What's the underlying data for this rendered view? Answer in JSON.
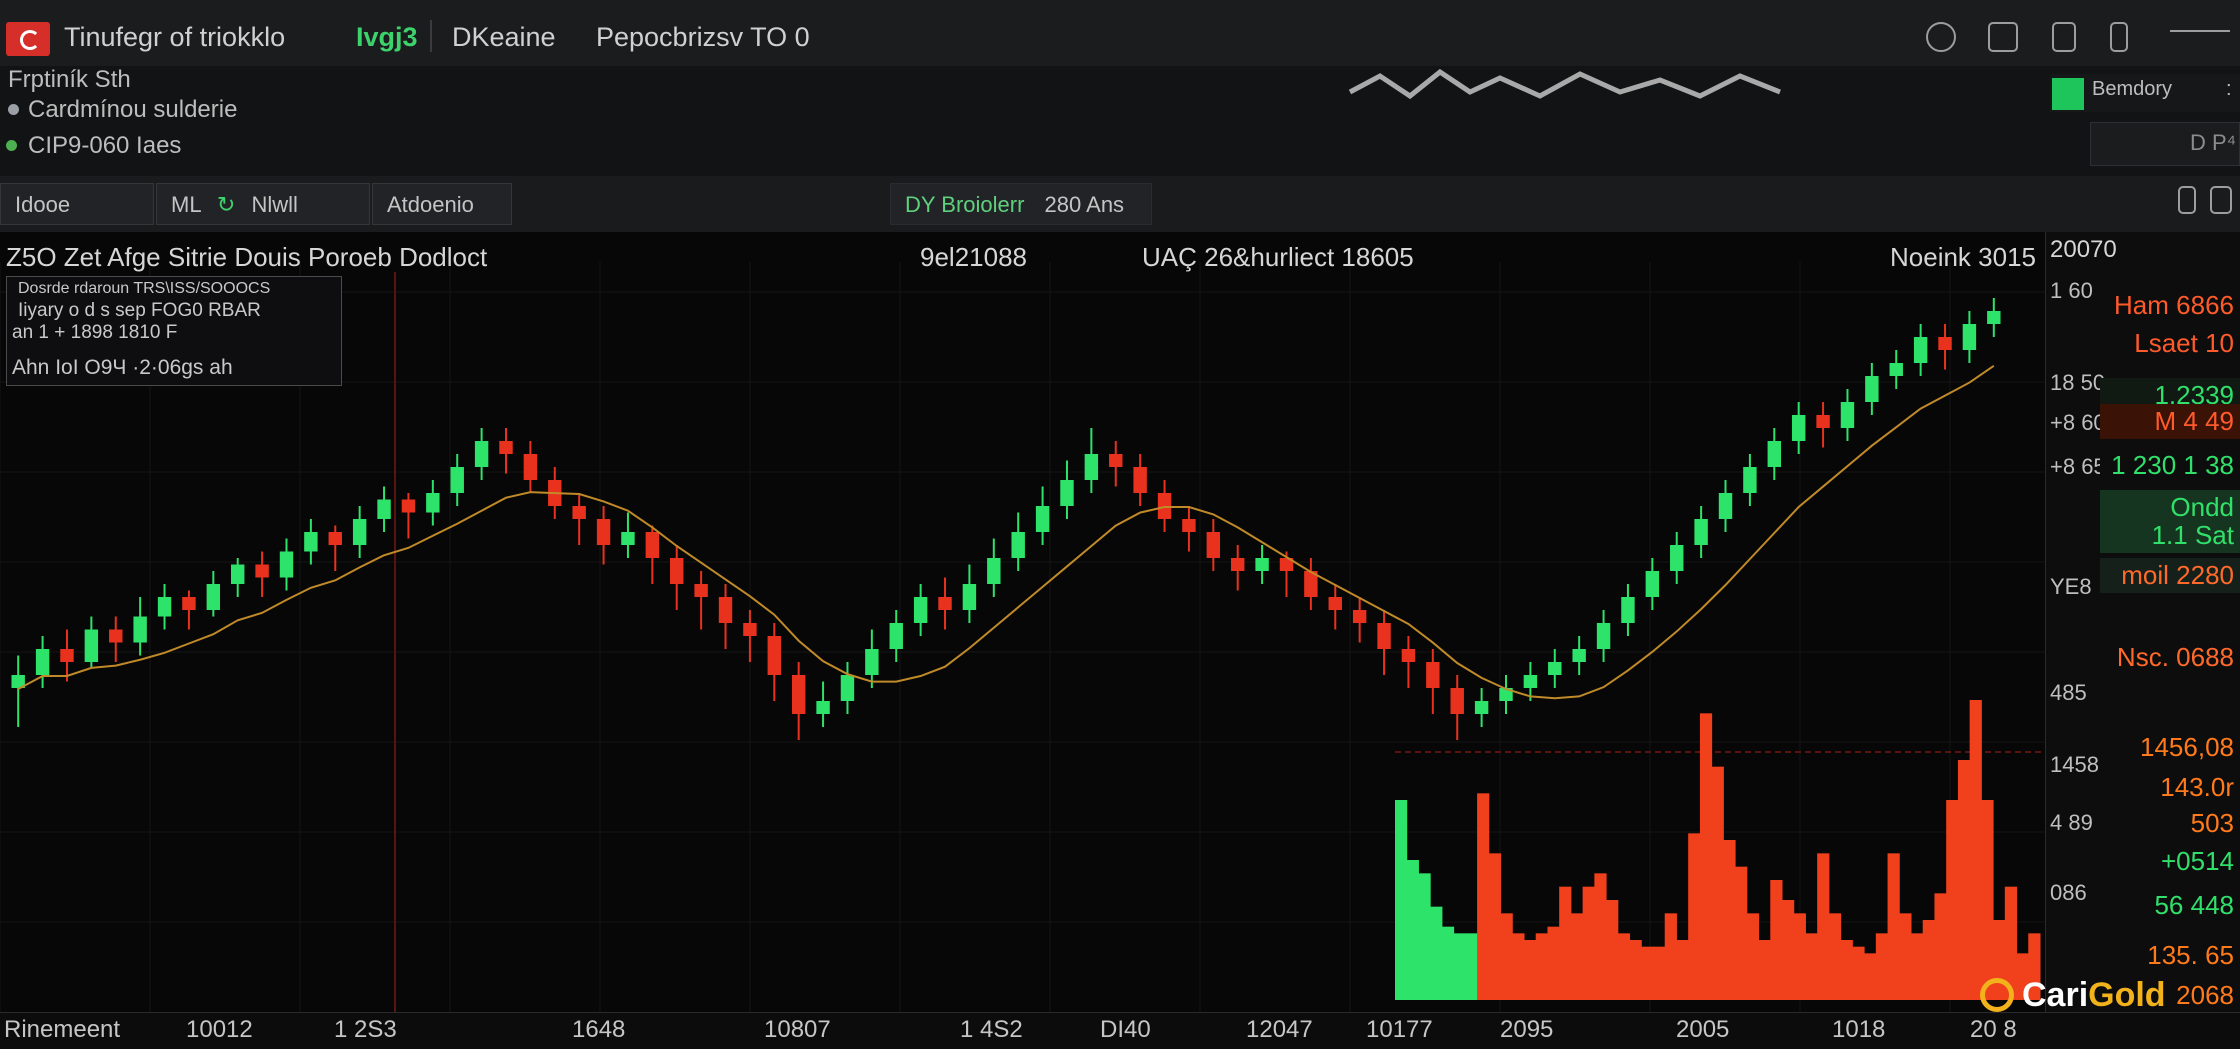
{
  "window": {
    "title": "Tinufegr of triokklo",
    "badge": "Ivgj3",
    "tab1": "DKeaine",
    "tab2": "Pepocbrizsv TO 0"
  },
  "info": {
    "line1": "Frptiník Sth",
    "line2": "Cardmínou sulderie",
    "line3": "CIP9-060 Iaes",
    "dot2_color": "#9aa0a6",
    "dot3_color": "#4caf50",
    "brand_button": "Bemdory",
    "brand_button_suffix": ":",
    "dp_box": "D P⁴"
  },
  "toolbar": {
    "btn1": "Idooe",
    "btn2": "ML",
    "btn2b": "Nlwll",
    "btn3": "Atdoenio",
    "indicator": "DY Broiolerr",
    "indicator_value": "280 Ans"
  },
  "chart_header": {
    "left": "Z5O Zet Afge Sitrie Douis Poroeb Dodloct",
    "center1": "9el21088",
    "center2": "UAÇ 26&hurliect 18605",
    "right": "Noeink 3015",
    "axis_top": "20070"
  },
  "legend": {
    "line1": "Dosrde rdaroun TRS\\ISS/SOOOCS",
    "line2": "Iiyary o d s sep  FOG0 RBAR",
    "line3": "an 1 + 1898  1810 F",
    "line4": "Ahn IoI O9Ч ·2·06gs ah"
  },
  "y_axis": {
    "labels": [
      "1 60",
      "18 50",
      "+8 60",
      "+8 65",
      "YE8",
      "485",
      "1458",
      "4 89",
      "086"
    ]
  },
  "price_tags": [
    {
      "text": "Ham 6866",
      "color": "#ff5a2a",
      "bg": "#0d0d0e"
    },
    {
      "text": "Lsaet 10",
      "color": "#ff5a2a",
      "bg": "#0d0d0e"
    },
    {
      "text": "1.2339",
      "color": "#31e06a",
      "bg": "#101a12"
    },
    {
      "text": "M 4 49",
      "color": "#ff5a2a",
      "bg": "#3a1206"
    },
    {
      "text": "1 230 1 38",
      "color": "#31e06a",
      "bg": "#0d0d0e"
    },
    {
      "text": "Ondd",
      "color": "#31e06a",
      "bg": "#163520"
    },
    {
      "text": "1.1 Sat",
      "color": "#31e06a",
      "bg": "#163520"
    },
    {
      "text": "moil 2280",
      "color": "#ff6a2a",
      "bg": "#16201a"
    },
    {
      "text": "Nsc. 0688",
      "color": "#ff6a2a",
      "bg": "#0d0d0e"
    },
    {
      "text": "1456,08",
      "color": "#ff7a1a",
      "bg": "#0d0d0e"
    },
    {
      "text": "143.0r",
      "color": "#ff7a1a",
      "bg": "#0d0d0e"
    },
    {
      "text": "503",
      "color": "#ff7a1a",
      "bg": "#0d0d0e"
    },
    {
      "text": "+0514",
      "color": "#31e06a",
      "bg": "#0d0d0e"
    },
    {
      "text": "56 448",
      "color": "#31e06a",
      "bg": "#0d0d0e"
    },
    {
      "text": "135. 65",
      "color": "#ff7a1a",
      "bg": "#0d0d0e"
    },
    {
      "text": "2068",
      "color": "#ff7a1a",
      "bg": "#0d0d0e"
    }
  ],
  "x_axis": {
    "labels": [
      "Rinemeent",
      "10012",
      "1 2S3",
      "1648",
      "10807",
      "1 4S2",
      "DI40",
      "12047",
      "10177",
      "2095",
      "2005",
      "1018",
      "20 8"
    ]
  },
  "brand": {
    "name_white": "Cari",
    "name_gold": "Gold",
    "gold_color": "#f2b21b"
  },
  "colors": {
    "up": "#2ee36a",
    "down": "#e8321e",
    "accent": "#d62f2a"
  },
  "chart_data": {
    "type": "candlestick",
    "candles": [
      [
        46,
        48,
        40,
        51
      ],
      [
        48,
        52,
        46,
        54
      ],
      [
        52,
        50,
        47,
        55
      ],
      [
        50,
        55,
        49,
        57
      ],
      [
        55,
        53,
        50,
        57
      ],
      [
        53,
        57,
        51,
        60
      ],
      [
        57,
        60,
        55,
        62
      ],
      [
        60,
        58,
        55,
        61
      ],
      [
        58,
        62,
        57,
        64
      ],
      [
        62,
        65,
        60,
        66
      ],
      [
        65,
        63,
        60,
        67
      ],
      [
        63,
        67,
        61,
        69
      ],
      [
        67,
        70,
        65,
        72
      ],
      [
        70,
        68,
        64,
        71
      ],
      [
        68,
        72,
        66,
        74
      ],
      [
        72,
        75,
        70,
        77
      ],
      [
        75,
        73,
        69,
        76
      ],
      [
        73,
        76,
        71,
        78
      ],
      [
        76,
        80,
        74,
        82
      ],
      [
        80,
        84,
        78,
        86
      ],
      [
        84,
        82,
        79,
        86
      ],
      [
        82,
        78,
        76,
        84
      ],
      [
        78,
        74,
        72,
        80
      ],
      [
        74,
        72,
        68,
        76
      ],
      [
        72,
        68,
        65,
        74
      ],
      [
        68,
        70,
        66,
        73
      ],
      [
        70,
        66,
        62,
        71
      ],
      [
        66,
        62,
        58,
        68
      ],
      [
        62,
        60,
        55,
        64
      ],
      [
        60,
        56,
        52,
        62
      ],
      [
        56,
        54,
        50,
        58
      ],
      [
        54,
        48,
        44,
        56
      ],
      [
        48,
        42,
        38,
        50
      ],
      [
        42,
        44,
        40,
        47
      ],
      [
        44,
        48,
        42,
        50
      ],
      [
        48,
        52,
        46,
        55
      ],
      [
        52,
        56,
        50,
        58
      ],
      [
        56,
        60,
        54,
        62
      ],
      [
        60,
        58,
        55,
        63
      ],
      [
        58,
        62,
        56,
        65
      ],
      [
        62,
        66,
        60,
        69
      ],
      [
        66,
        70,
        64,
        73
      ],
      [
        70,
        74,
        68,
        77
      ],
      [
        74,
        78,
        72,
        81
      ],
      [
        78,
        82,
        76,
        86
      ],
      [
        82,
        80,
        77,
        84
      ],
      [
        80,
        76,
        74,
        82
      ],
      [
        76,
        72,
        70,
        78
      ],
      [
        72,
        70,
        67,
        74
      ],
      [
        70,
        66,
        64,
        72
      ],
      [
        66,
        64,
        61,
        68
      ],
      [
        64,
        66,
        62,
        68
      ],
      [
        66,
        64,
        60,
        67
      ],
      [
        64,
        60,
        58,
        66
      ],
      [
        60,
        58,
        55,
        62
      ],
      [
        58,
        56,
        53,
        60
      ],
      [
        56,
        52,
        48,
        58
      ],
      [
        52,
        50,
        46,
        54
      ],
      [
        50,
        46,
        42,
        52
      ],
      [
        46,
        42,
        38,
        48
      ],
      [
        42,
        44,
        40,
        46
      ],
      [
        44,
        46,
        42,
        48
      ],
      [
        46,
        48,
        44,
        50
      ],
      [
        48,
        50,
        46,
        52
      ],
      [
        50,
        52,
        48,
        54
      ],
      [
        52,
        56,
        50,
        58
      ],
      [
        56,
        60,
        54,
        62
      ],
      [
        60,
        64,
        58,
        66
      ],
      [
        64,
        68,
        62,
        70
      ],
      [
        68,
        72,
        66,
        74
      ],
      [
        72,
        76,
        70,
        78
      ],
      [
        76,
        80,
        74,
        82
      ],
      [
        80,
        84,
        78,
        86
      ],
      [
        84,
        88,
        82,
        90
      ],
      [
        88,
        86,
        83,
        90
      ],
      [
        86,
        90,
        84,
        92
      ],
      [
        90,
        94,
        88,
        96
      ],
      [
        94,
        96,
        92,
        98
      ],
      [
        96,
        100,
        94,
        102
      ],
      [
        100,
        98,
        95,
        102
      ],
      [
        98,
        102,
        96,
        104
      ],
      [
        102,
        104,
        100,
        106
      ]
    ],
    "volume": [
      60,
      42,
      38,
      28,
      22,
      20,
      20,
      62,
      44,
      26,
      20,
      18,
      20,
      22,
      34,
      26,
      34,
      38,
      30,
      20,
      18,
      16,
      16,
      26,
      18,
      50,
      86,
      70,
      48,
      40,
      26,
      18,
      36,
      30,
      26,
      20,
      44,
      26,
      18,
      16,
      14,
      20,
      44,
      26,
      20,
      24,
      32,
      60,
      72,
      90,
      60,
      24,
      34,
      14,
      20
    ],
    "volume_colors": [
      "up",
      "up",
      "up",
      "up",
      "up",
      "up",
      "up",
      "down",
      "down",
      "down",
      "down",
      "down",
      "down",
      "down",
      "down",
      "down",
      "down",
      "down",
      "down",
      "down",
      "down",
      "down",
      "down",
      "down",
      "down",
      "down",
      "down",
      "down",
      "down",
      "down",
      "down",
      "down",
      "down",
      "down",
      "down",
      "down",
      "down",
      "down",
      "down",
      "down",
      "down",
      "down",
      "down",
      "down",
      "down",
      "down",
      "down",
      "down",
      "down",
      "down",
      "down",
      "down",
      "down",
      "down",
      "down"
    ]
  }
}
